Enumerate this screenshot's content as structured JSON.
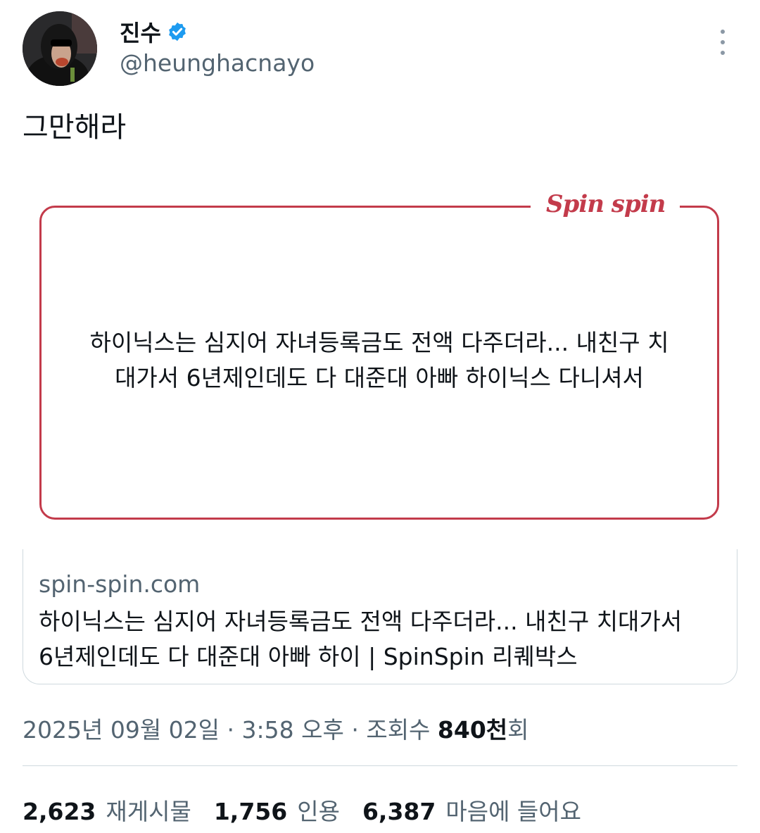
{
  "author": {
    "display_name": "진수",
    "handle": "@heunghacnayo",
    "verified_icon": "verified-badge-icon",
    "verified_color": "#1d9bf0"
  },
  "more_icon": "more-vertical-icon",
  "tweet_text": "그만해라",
  "media_card": {
    "logo": "Spin spin",
    "headline_line1": "하이닉스는 심지어 자녀등록금도 전액 다주더라... 내친구 치",
    "headline_line2": "대가서 6년제인데도 다 대준대 아빠 하이닉스 다니셔서",
    "accent_color": "#c33b4b"
  },
  "link_card": {
    "domain": "spin-spin.com",
    "title_line1": "하이닉스는 심지어 자녀등록금도 전액 다주더라... 내친구 치대가서",
    "title_line2": "6년제인데도 다 대준대 아빠 하이 | SpinSpin 리퀘박스"
  },
  "meta": {
    "date": "2025년 09월 02일",
    "separator": " · ",
    "time": "3:58 오후",
    "views_label": "조회수 ",
    "views_value": "840천",
    "views_suffix": "회"
  },
  "stats": [
    {
      "value": "2,623",
      "label": "재게시물"
    },
    {
      "value": "1,756",
      "label": "인용"
    },
    {
      "value": "6,387",
      "label": "마음에 들어요"
    }
  ]
}
